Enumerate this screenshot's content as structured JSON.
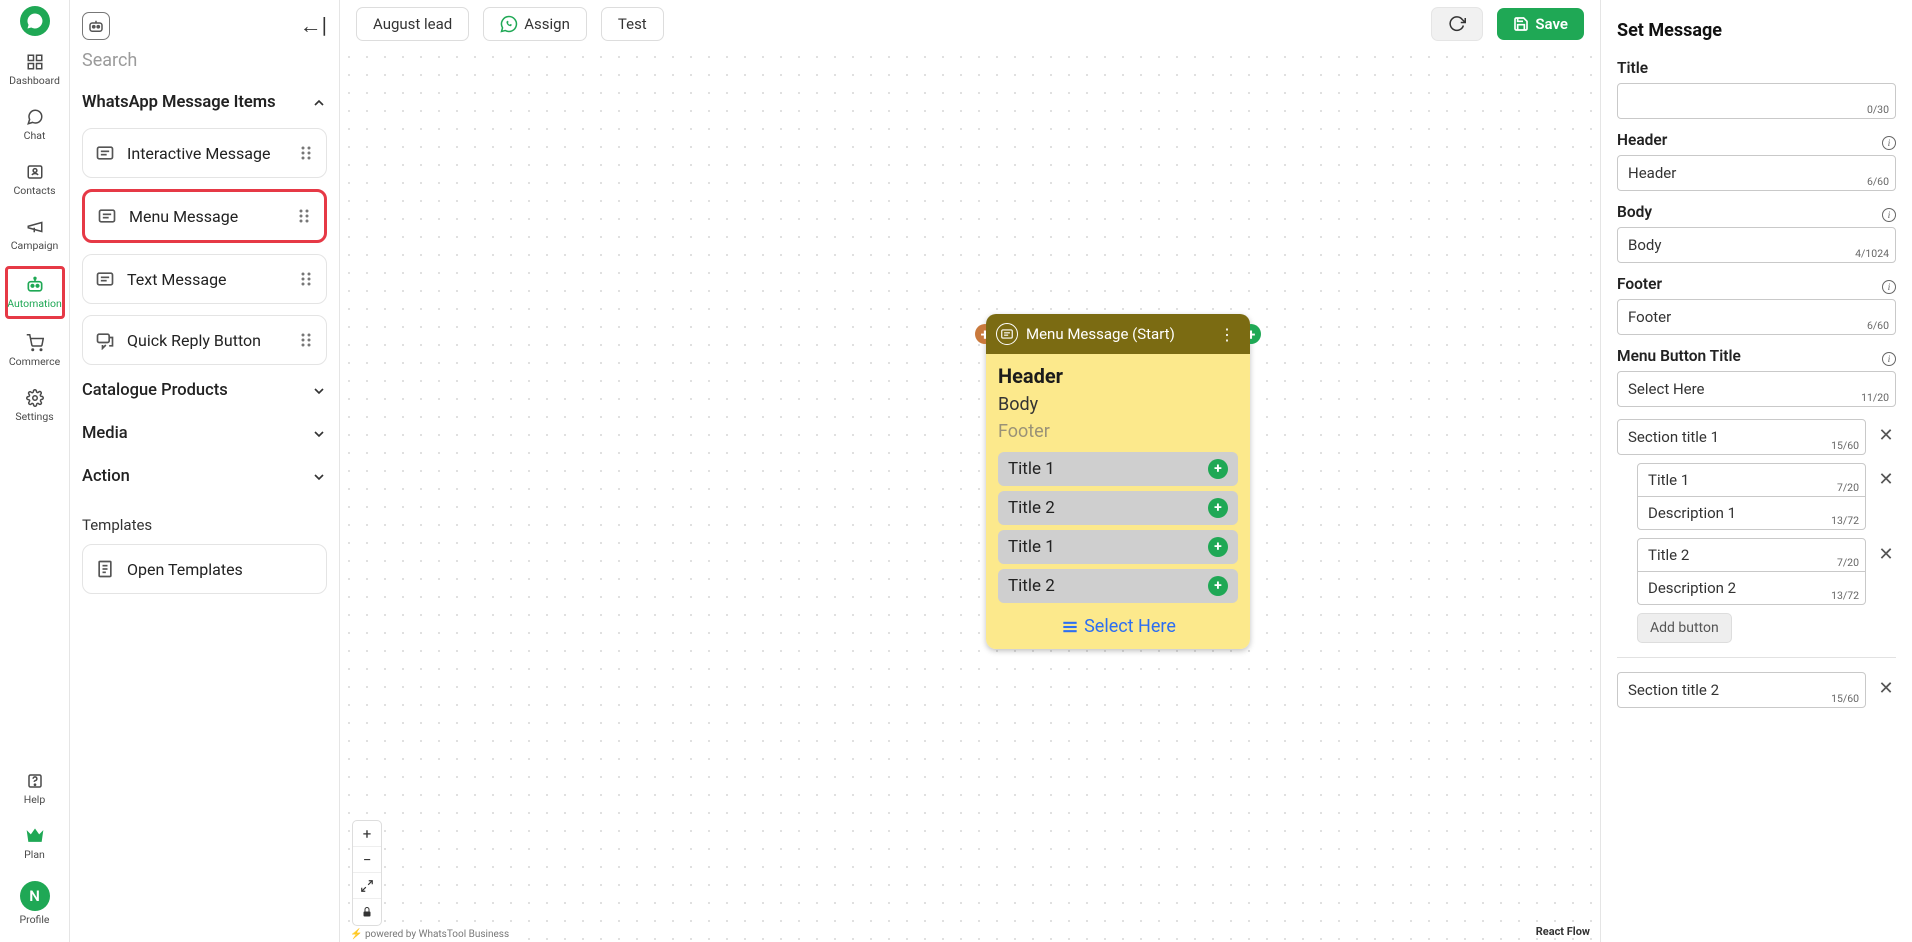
{
  "nav": {
    "items": [
      {
        "label": "Dashboard",
        "icon": "dashboard"
      },
      {
        "label": "Chat",
        "icon": "chat"
      },
      {
        "label": "Contacts",
        "icon": "contacts"
      },
      {
        "label": "Campaign",
        "icon": "campaign"
      },
      {
        "label": "Automation",
        "icon": "automation",
        "active": true,
        "highlight": true
      },
      {
        "label": "Commerce",
        "icon": "commerce"
      },
      {
        "label": "Settings",
        "icon": "settings"
      }
    ],
    "bottom": [
      {
        "label": "Help",
        "icon": "help"
      },
      {
        "label": "Plan",
        "icon": "plan"
      },
      {
        "label": "Profile",
        "icon": "profile",
        "initial": "N"
      }
    ]
  },
  "sidebar": {
    "search_placeholder": "Search",
    "sections": {
      "whatsapp": {
        "title": "WhatsApp Message Items",
        "items": [
          {
            "label": "Interactive Message"
          },
          {
            "label": "Menu Message",
            "highlight": true
          },
          {
            "label": "Text Message"
          },
          {
            "label": "Quick Reply Button"
          }
        ]
      },
      "catalogue": {
        "title": "Catalogue Products"
      },
      "media": {
        "title": "Media"
      },
      "action": {
        "title": "Action"
      }
    },
    "templates_title": "Templates",
    "open_templates": "Open Templates"
  },
  "toolbar": {
    "name": "August lead",
    "assign": "Assign",
    "test": "Test",
    "save": "Save"
  },
  "node": {
    "title": "Menu Message (Start)",
    "header": "Header",
    "body": "Body",
    "footer": "Footer",
    "rows": [
      "Title 1",
      "Title 2",
      "Title 1",
      "Title 2"
    ],
    "select": "Select Here"
  },
  "canvas": {
    "powered": "powered by WhatsTool Business",
    "reactflow": "React Flow"
  },
  "rpanel": {
    "heading": "Set Message",
    "title": {
      "label": "Title",
      "value": "",
      "count": "0/30"
    },
    "header": {
      "label": "Header",
      "value": "Header",
      "count": "6/60"
    },
    "body": {
      "label": "Body",
      "value": "Body",
      "count": "4/1024"
    },
    "footer": {
      "label": "Footer",
      "value": "Footer",
      "count": "6/60"
    },
    "menubtn": {
      "label": "Menu Button Title",
      "value": "Select Here",
      "count": "11/20"
    },
    "section1": {
      "title": "Section title 1",
      "count": "15/60"
    },
    "s1_items": [
      {
        "title": "Title 1",
        "tcount": "7/20",
        "desc": "Description 1",
        "dcount": "13/72"
      },
      {
        "title": "Title 2",
        "tcount": "7/20",
        "desc": "Description 2",
        "dcount": "13/72"
      }
    ],
    "addbtn": "Add button",
    "section2": {
      "title": "Section title 2",
      "count": "15/60"
    }
  }
}
